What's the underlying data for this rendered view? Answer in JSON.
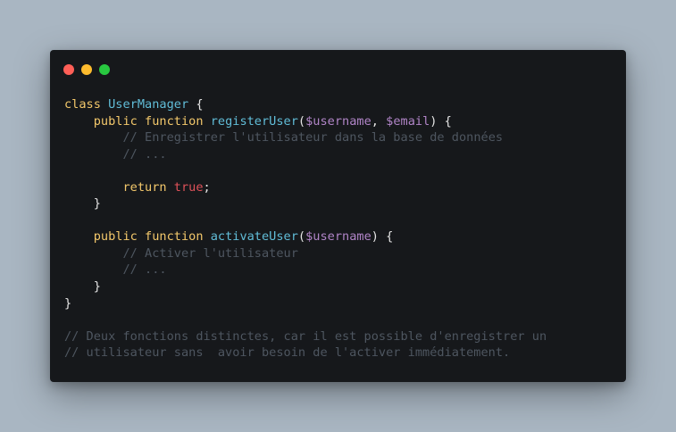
{
  "window": {
    "controls": [
      {
        "name": "close",
        "color": "#ff5f57"
      },
      {
        "name": "minimize",
        "color": "#febc2e"
      },
      {
        "name": "zoom",
        "color": "#28c840"
      }
    ]
  },
  "colors": {
    "background": "#a9b6c2",
    "editor": "#16181b",
    "keyword": "#f3c86b",
    "function": "#61bdd8",
    "variable": "#b185c8",
    "boolean": "#e0525a",
    "comment": "#4e5660",
    "plain": "#e6e6e6"
  },
  "code": {
    "lines": [
      [
        {
          "t": "kw",
          "v": "class"
        },
        {
          "t": "pl",
          "v": " "
        },
        {
          "t": "fn",
          "v": "UserManager"
        },
        {
          "t": "pl",
          "v": " {"
        }
      ],
      [
        {
          "t": "pl",
          "v": "    "
        },
        {
          "t": "kw",
          "v": "public function"
        },
        {
          "t": "pl",
          "v": " "
        },
        {
          "t": "fn",
          "v": "registerUser"
        },
        {
          "t": "pl",
          "v": "("
        },
        {
          "t": "var",
          "v": "$username"
        },
        {
          "t": "pl",
          "v": ", "
        },
        {
          "t": "var",
          "v": "$email"
        },
        {
          "t": "pl",
          "v": ") {"
        }
      ],
      [
        {
          "t": "pl",
          "v": "        "
        },
        {
          "t": "cm",
          "v": "// Enregistrer l'utilisateur dans la base de données"
        }
      ],
      [
        {
          "t": "pl",
          "v": "        "
        },
        {
          "t": "cm",
          "v": "// ..."
        }
      ],
      [],
      [
        {
          "t": "pl",
          "v": "        "
        },
        {
          "t": "kw",
          "v": "return"
        },
        {
          "t": "pl",
          "v": " "
        },
        {
          "t": "bool",
          "v": "true"
        },
        {
          "t": "pl",
          "v": ";"
        }
      ],
      [
        {
          "t": "pl",
          "v": "    }"
        }
      ],
      [],
      [
        {
          "t": "pl",
          "v": "    "
        },
        {
          "t": "kw",
          "v": "public function"
        },
        {
          "t": "pl",
          "v": " "
        },
        {
          "t": "fn",
          "v": "activateUser"
        },
        {
          "t": "pl",
          "v": "("
        },
        {
          "t": "var",
          "v": "$username"
        },
        {
          "t": "pl",
          "v": ") {"
        }
      ],
      [
        {
          "t": "pl",
          "v": "        "
        },
        {
          "t": "cm",
          "v": "// Activer l'utilisateur"
        }
      ],
      [
        {
          "t": "pl",
          "v": "        "
        },
        {
          "t": "cm",
          "v": "// ..."
        }
      ],
      [
        {
          "t": "pl",
          "v": "    }"
        }
      ],
      [
        {
          "t": "pl",
          "v": "}"
        }
      ],
      [],
      [
        {
          "t": "cm",
          "v": "// Deux fonctions distinctes, car il est possible d'enregistrer un"
        }
      ],
      [
        {
          "t": "cm",
          "v": "// utilisateur sans  avoir besoin de l'activer immédiatement."
        }
      ]
    ]
  }
}
